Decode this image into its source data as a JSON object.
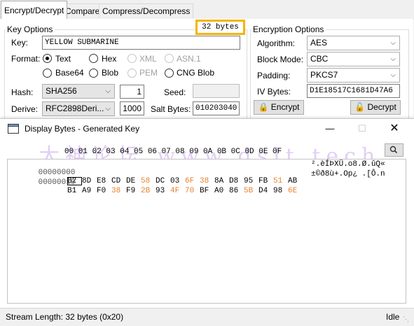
{
  "tabs": [
    "Encrypt/Decrypt",
    "Compare",
    "Compress/Decompress"
  ],
  "key_options": {
    "legend": "Key Options",
    "bytes_badge": "32 bytes",
    "key_label": "Key:",
    "key_value": "YELLOW SUBMARINE",
    "format_label": "Format:",
    "formats": [
      "Text",
      "Hex",
      "XML",
      "ASN.1",
      "Base64",
      "Blob",
      "PEM",
      "CNG Blob"
    ],
    "hash_label": "Hash:",
    "hash_value": "SHA256",
    "hash_count": "1",
    "seed_label": "Seed:",
    "derive_label": "Derive:",
    "derive_value": "RFC2898Deri...",
    "derive_count": "1000",
    "salt_label": "Salt Bytes:",
    "salt_value": "010203040"
  },
  "encryption_options": {
    "legend": "Encryption Options",
    "algorithm_label": "Algorithm:",
    "algorithm_value": "AES",
    "mode_label": "Block Mode:",
    "mode_value": "CBC",
    "padding_label": "Padding:",
    "padding_value": "PKCS7",
    "iv_label": "IV Bytes:",
    "iv_value": "D1E18517C1681D47A6",
    "encrypt_label": "Encrypt",
    "decrypt_label": "Decrypt"
  },
  "dialog": {
    "title": "Display Bytes - Generated Key",
    "column_header": "00 01 02 03 04 05 06 07 08 09 0A 0B 0C 0D 0E 0F",
    "rows": [
      {
        "offset": "00000000",
        "bytes": [
          "B2",
          "8D",
          "E8",
          "CD",
          "DE",
          "58",
          "DC",
          "03",
          "6F",
          "38",
          "8A",
          "D8",
          "95",
          "FB",
          "51",
          "AB"
        ],
        "ascii": "².èÍÞXÜ.o8.Ø.ûQ«"
      },
      {
        "offset": "00000010",
        "bytes": [
          "B1",
          "A9",
          "F0",
          "38",
          "F9",
          "2B",
          "93",
          "4F",
          "70",
          "BF",
          "A0",
          "86",
          "5B",
          "D4",
          "98",
          "6E"
        ],
        "ascii": "±©ð8ù+.Op¿ .[Ô.n"
      }
    ],
    "status_text": "Stream Length: 32 bytes (0x20)",
    "status_state": "Idle",
    "watermark": "大神论坛 www.dslt.tech",
    "highlight_color": "#e8812d",
    "badge_border_color": "#f5b400"
  }
}
